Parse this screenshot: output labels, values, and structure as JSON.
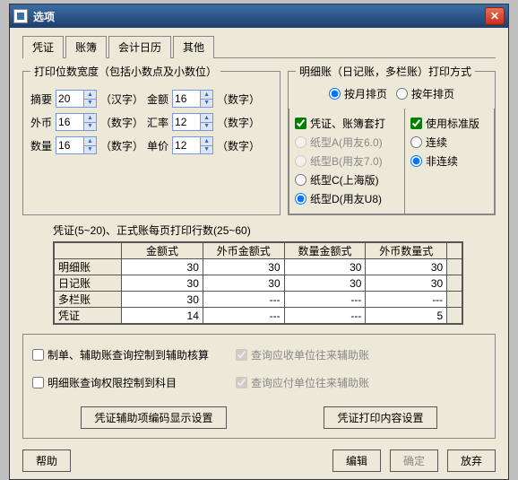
{
  "window": {
    "title": "选项"
  },
  "tabs": [
    "凭证",
    "账簿",
    "会计日历",
    "其他"
  ],
  "activeTab": 1,
  "group1": {
    "legend": "打印位数宽度（包括小数点及小数位）",
    "rows": [
      {
        "l1": "摘要",
        "v1": "20",
        "hint1": "（汉字）",
        "l2": "金额",
        "v2": "16",
        "hint2": "（数字）"
      },
      {
        "l1": "外币",
        "v1": "16",
        "hint1": "（数字）",
        "l2": "汇率",
        "v2": "12",
        "hint2": "（数字）"
      },
      {
        "l1": "数量",
        "v1": "16",
        "hint1": "（数字）",
        "l2": "单价",
        "v2": "12",
        "hint2": "（数字）"
      }
    ]
  },
  "group2": {
    "legend": "明细账（日记账，多栏账）打印方式",
    "radioTop": [
      {
        "label": "按月排页",
        "checked": true
      },
      {
        "label": "按年排页",
        "checked": false
      }
    ],
    "leftChk": {
      "label": "凭证、账簿套打",
      "checked": true
    },
    "leftRadios": [
      {
        "label": "纸型A(用友6.0)",
        "disabled": true
      },
      {
        "label": "纸型B(用友7.0)",
        "disabled": true
      },
      {
        "label": "纸型C(上海版)",
        "checked": false
      },
      {
        "label": "纸型D(用友U8)",
        "checked": true
      }
    ],
    "rightChk": {
      "label": "使用标准版",
      "checked": true
    },
    "rightRadios": [
      {
        "label": "连续",
        "checked": false
      },
      {
        "label": "非连续",
        "checked": true
      }
    ]
  },
  "tableTitle": "凭证(5~20)、正式账每页打印行数(25~60)",
  "cols": [
    "",
    "金额式",
    "外币金额式",
    "数量金额式",
    "外币数量式",
    ""
  ],
  "rows": [
    {
      "h": "明细账",
      "c": [
        "30",
        "30",
        "30",
        "30"
      ]
    },
    {
      "h": "日记账",
      "c": [
        "30",
        "30",
        "30",
        "30"
      ]
    },
    {
      "h": "多栏账",
      "c": [
        "30",
        "---",
        "---",
        "---"
      ]
    },
    {
      "h": "凭证",
      "c": [
        "14",
        "---",
        "---",
        "5"
      ]
    }
  ],
  "panelChecks": {
    "left": [
      "制单、辅助账查询控制到辅助核算",
      "明细账查询权限控制到科目"
    ],
    "right": [
      "查询应收单位往来辅助账",
      "查询应付单位往来辅助账"
    ]
  },
  "bigButtons": [
    "凭证辅助项编码显示设置",
    "凭证打印内容设置"
  ],
  "footer": {
    "help": "帮助",
    "edit": "编辑",
    "ok": "确定",
    "cancel": "放弃"
  }
}
